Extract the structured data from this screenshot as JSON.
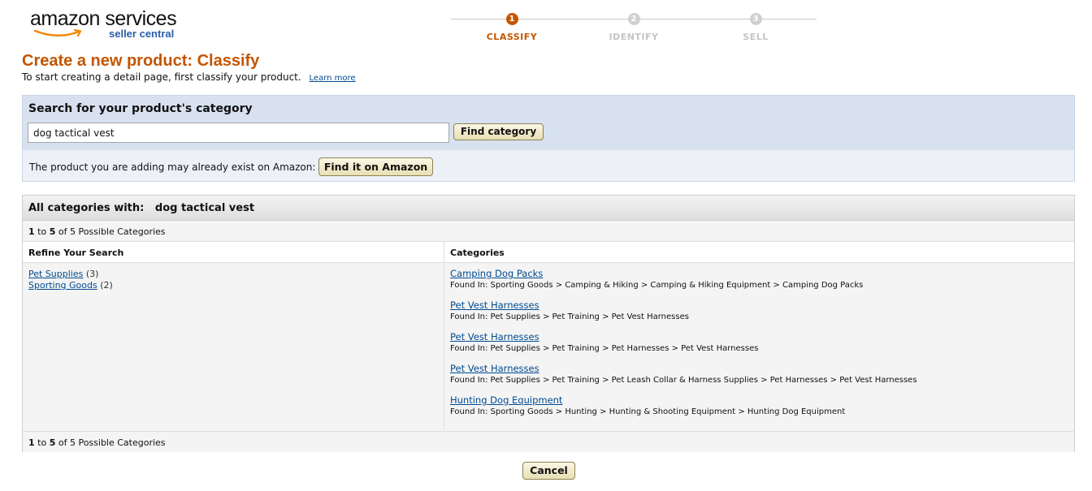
{
  "logo": {
    "main": "amazon services",
    "sub": "seller central"
  },
  "stepper": {
    "steps": [
      {
        "number": "1",
        "label": "CLASSIFY"
      },
      {
        "number": "2",
        "label": "IDENTIFY"
      },
      {
        "number": "3",
        "label": "SELL"
      }
    ],
    "active_step": 1
  },
  "title": "Create a new product: Classify",
  "subtitle": "To start creating a detail page, first classify your product.",
  "learn_more": "Learn more",
  "search": {
    "heading": "Search for your product's category",
    "input_value": "dog tactical vest",
    "find_category_label": "Find category",
    "exist_text": "The product you are adding may already exist on Amazon:",
    "find_on_amazon_label": "Find it on Amazon"
  },
  "results": {
    "heading_prefix": "All categories with:",
    "query": "dog tactical vest",
    "count_from": "1",
    "count_to_word": "to",
    "count_to": "5",
    "count_suffix": "of 5 Possible Categories",
    "refine_heading": "Refine Your Search",
    "categories_heading": "Categories",
    "refine": [
      {
        "label": "Pet Supplies",
        "count": "(3)"
      },
      {
        "label": "Sporting Goods",
        "count": "(2)"
      }
    ],
    "categories": [
      {
        "name": "Camping Dog Packs",
        "found_in": "Found In: Sporting Goods > Camping & Hiking > Camping & Hiking Equipment > Camping Dog Packs"
      },
      {
        "name": "Pet Vest Harnesses",
        "found_in": "Found In: Pet Supplies > Pet Training > Pet Vest Harnesses"
      },
      {
        "name": "Pet Vest Harnesses",
        "found_in": "Found In: Pet Supplies > Pet Training > Pet Harnesses > Pet Vest Harnesses"
      },
      {
        "name": "Pet Vest Harnesses",
        "found_in": "Found In: Pet Supplies > Pet Training > Pet Leash Collar & Harness Supplies > Pet Harnesses > Pet Vest Harnesses"
      },
      {
        "name": "Hunting Dog Equipment",
        "found_in": "Found In: Sporting Goods > Hunting > Hunting & Shooting Equipment > Hunting Dog Equipment"
      }
    ]
  },
  "cancel_label": "Cancel",
  "colors": {
    "accent": "#c45500",
    "link": "#004b91",
    "search_bg": "#d7e1f0"
  }
}
